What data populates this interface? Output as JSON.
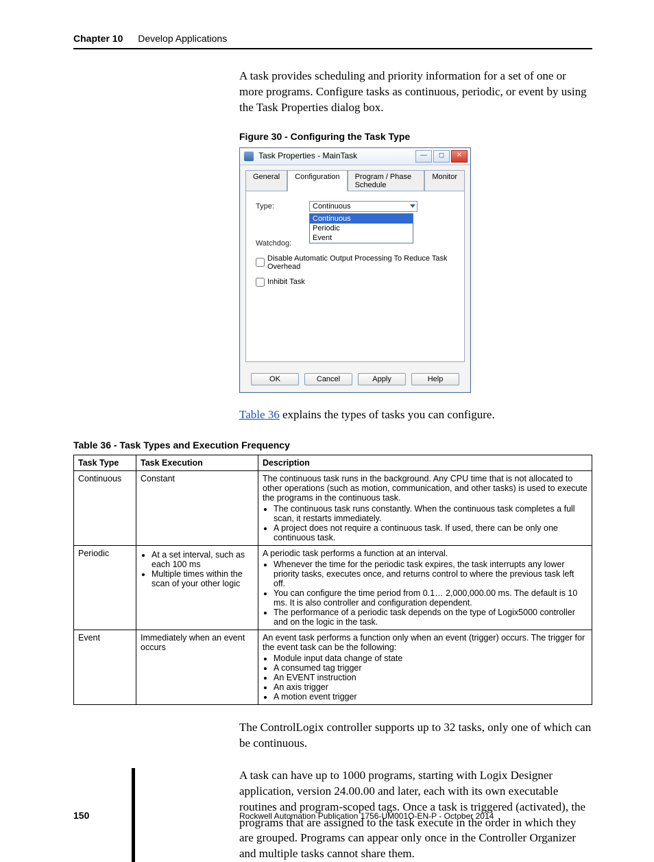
{
  "header": {
    "chapter": "Chapter 10",
    "title": "Develop Applications"
  },
  "intro": "A task provides scheduling and priority information for a set of one or more programs. Configure tasks as continuous, periodic, or event by using the Task Properties dialog box.",
  "figure_caption": "Figure 30 - Configuring the Task Type",
  "dialog": {
    "title": "Task Properties - MainTask",
    "tabs": [
      "General",
      "Configuration",
      "Program / Phase Schedule",
      "Monitor"
    ],
    "active_tab": "Configuration",
    "type_label": "Type:",
    "type_value": "Continuous",
    "type_options": [
      "Continuous",
      "Periodic",
      "Event"
    ],
    "watchdog_label": "Watchdog:",
    "chk_disable": "Disable Automatic Output Processing To Reduce Task Overhead",
    "chk_inhibit": "Inhibit Task",
    "buttons": {
      "ok": "OK",
      "cancel": "Cancel",
      "apply": "Apply",
      "help": "Help"
    }
  },
  "after_figure_pre": "",
  "table_link": "Table 36",
  "after_figure_post": " explains the types of tasks you can configure.",
  "table_caption": "Table 36 - Task Types and Execution Frequency",
  "table": {
    "headers": [
      "Task Type",
      "Task Execution",
      "Description"
    ],
    "rows": [
      {
        "type": "Continuous",
        "exec_text": "Constant",
        "exec_bullets": [],
        "desc_text": "The continuous task runs in the background. Any CPU time that is not allocated to other operations (such as motion, communication, and other tasks) is used to execute the programs in the continuous task.",
        "desc_bullets": [
          "The continuous task runs constantly. When the continuous task completes a full scan, it restarts immediately.",
          "A project does not require a continuous task. If used, there can be only one continuous task."
        ]
      },
      {
        "type": "Periodic",
        "exec_text": "",
        "exec_bullets": [
          "At a set interval, such as each 100 ms",
          "Multiple times within the scan of your other logic"
        ],
        "desc_text": "A periodic task performs a function at an interval.",
        "desc_bullets": [
          "Whenever the time for the periodic task expires, the task interrupts any lower priority tasks, executes once, and returns control to where the previous task left off.",
          "You can configure the time period from 0.1… 2,000,000.00 ms. The default is 10 ms. It is also controller and configuration dependent.",
          "The performance of a periodic task depends on the type of Logix5000 controller and on the logic in the task."
        ]
      },
      {
        "type": "Event",
        "exec_text": "Immediately when an event occurs",
        "exec_bullets": [],
        "desc_text": "An event task performs a function only when an event (trigger) occurs. The trigger for the event task can be the following:",
        "desc_bullets": [
          "Module input data change of state",
          "A consumed tag trigger",
          "An EVENT instruction",
          "An axis trigger",
          "A motion event trigger"
        ]
      }
    ]
  },
  "para1": "The ControlLogix controller supports up to 32 tasks, only one of which can be continuous.",
  "para2": "A task can have up to 1000 programs, starting with Logix Designer application, version 24.00.00 and later, each with its own executable routines and program-scoped tags. Once a task is triggered (activated), the programs that are assigned to the task execute in the order in which they are grouped. Programs can appear only once in the Controller Organizer and multiple tasks cannot share them.",
  "footer": {
    "page": "150",
    "pub": "Rockwell Automation Publication 1756-UM001O-EN-P - October 2014"
  }
}
